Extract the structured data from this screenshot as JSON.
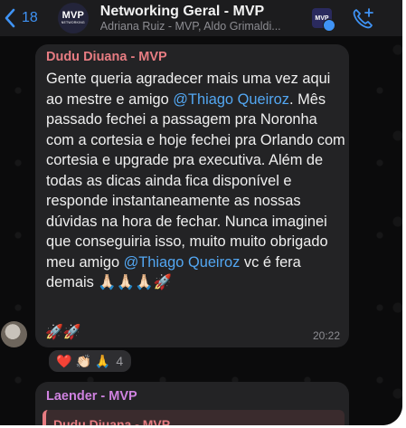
{
  "header": {
    "back_count": "18",
    "avatar_top": "MVP",
    "avatar_bottom": "NETWORKING",
    "title": "Networking Geral - MVP",
    "subtitle": "Adriana Ruiz - MVP, Aldo Grimaldi...",
    "mini_logo": "MVP"
  },
  "message": {
    "sender": "Dudu Diuana - MVP",
    "text_1": "Gente queria agradecer mais uma vez aqui ao mestre e amigo ",
    "mention_1": "@Thiago Queiroz",
    "text_2": ". Mês passado fechei a passagem pra Noronha com a cortesia e hoje fechei pra Orlando com cortesia e upgrade pra executiva. Além de todas as dicas ainda fica disponível e responde instantaneamente as nossas dúvidas na hora de fechar. Nunca imaginei que conseguiria isso, muito muito obrigado meu amigo ",
    "mention_2": "@Thiago Queiroz",
    "text_3": " vc é fera demais 🙏🏻🙏🏻🙏🏻🚀",
    "emoji_line": "🚀🚀",
    "time": "20:22"
  },
  "reactions": {
    "emojis": [
      "❤️",
      "👏🏻",
      "🙏"
    ],
    "count": "4"
  },
  "next_message": {
    "sender": "Laender - MVP",
    "quoted_sender": "Dudu Diuana - MVP"
  },
  "colors": {
    "accent": "#3f93f5",
    "sender_name": "#e77c82",
    "mention": "#53a7f2",
    "sender2_name": "#cf82e0"
  }
}
